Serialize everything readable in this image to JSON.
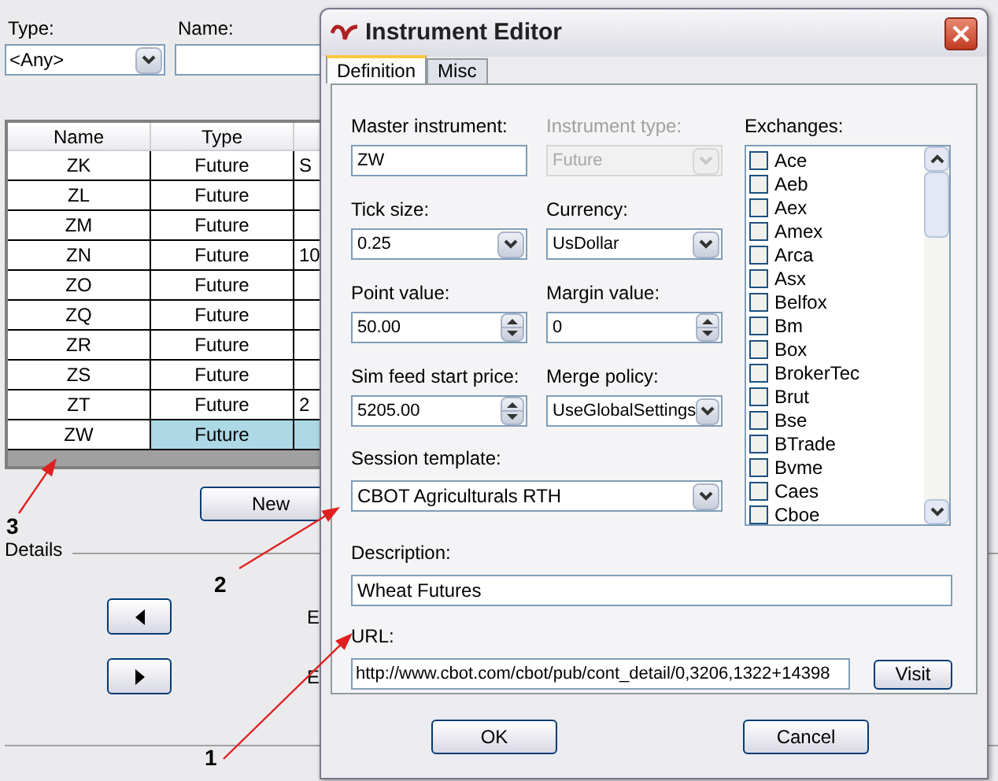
{
  "filter": {
    "type_label": "Type:",
    "type_value": "<Any>",
    "name_label": "Name:"
  },
  "table": {
    "columns": [
      "Name",
      "Type"
    ],
    "rows": [
      {
        "cells": [
          "ZK",
          "Future"
        ],
        "column_3": "S",
        "selected": false
      },
      {
        "cells": [
          "ZL",
          "Future"
        ],
        "selected": false
      },
      {
        "cells": [
          "ZM",
          "Future"
        ],
        "selected": false
      },
      {
        "cells": [
          "ZN",
          "Future"
        ],
        "column_3": "10",
        "selected": false
      },
      {
        "cells": [
          "ZO",
          "Future"
        ],
        "selected": false
      },
      {
        "cells": [
          "ZQ",
          "Future"
        ],
        "selected": false
      },
      {
        "cells": [
          "ZR",
          "Future"
        ],
        "selected": false
      },
      {
        "cells": [
          "ZS",
          "Future"
        ],
        "selected": false
      },
      {
        "cells": [
          "ZT",
          "Future"
        ],
        "column_3": "2",
        "selected": false
      },
      {
        "cells": [
          "ZW",
          "Future"
        ],
        "selected": true
      }
    ]
  },
  "new_button": "New",
  "details_label": "Details",
  "nav_buttons": [
    {
      "kind": "left",
      "label": "E"
    },
    {
      "kind": "right",
      "label": "E"
    }
  ],
  "dialog": {
    "title": "Instrument Editor",
    "tabs": [
      {
        "label": "Definition",
        "selected": true
      },
      {
        "label": "Misc",
        "selected": false
      }
    ],
    "fields": [
      {
        "label": "Master instrument:",
        "kind": "text",
        "value": "ZW",
        "disabled": false
      },
      {
        "label": "Instrument type:",
        "kind": "select",
        "value": "Future",
        "disabled": true
      },
      {
        "label": "Tick size:",
        "kind": "select",
        "value": "0.25",
        "disabled": false
      },
      {
        "label": "Currency:",
        "kind": "select",
        "value": "UsDollar",
        "disabled": false
      },
      {
        "label": "Point value:",
        "kind": "spin",
        "value": "50.00",
        "disabled": false
      },
      {
        "label": "Margin value:",
        "kind": "spin",
        "value": "0",
        "disabled": false
      },
      {
        "label": "Sim feed start price:",
        "kind": "spin",
        "value": "5205.00",
        "disabled": false
      },
      {
        "label": "Merge policy:",
        "kind": "select",
        "value": "UseGlobalSettings",
        "disabled": false
      }
    ],
    "session_template": {
      "label": "Session template:",
      "value": "CBOT Agriculturals RTH"
    },
    "exchanges": {
      "label": "Exchanges:",
      "items": [
        {
          "label": "Ace",
          "checked": false
        },
        {
          "label": "Aeb",
          "checked": false
        },
        {
          "label": "Aex",
          "checked": false
        },
        {
          "label": "Amex",
          "checked": false
        },
        {
          "label": "Arca",
          "checked": false
        },
        {
          "label": "Asx",
          "checked": false
        },
        {
          "label": "Belfox",
          "checked": false
        },
        {
          "label": "Bm",
          "checked": false
        },
        {
          "label": "Box",
          "checked": false
        },
        {
          "label": "BrokerTec",
          "checked": false
        },
        {
          "label": "Brut",
          "checked": false
        },
        {
          "label": "Bse",
          "checked": false
        },
        {
          "label": "BTrade",
          "checked": false
        },
        {
          "label": "Bvme",
          "checked": false
        },
        {
          "label": "Caes",
          "checked": false
        },
        {
          "label": "Cboe",
          "checked": false
        }
      ]
    },
    "description": {
      "label": "Description:",
      "value": "Wheat Futures"
    },
    "url": {
      "label": "URL:",
      "value": "http://www.cbot.com/cbot/pub/cont_detail/0,3206,1322+14398"
    },
    "visit_button": "Visit",
    "buttons": [
      "OK",
      "Cancel"
    ]
  },
  "annotations": [
    {
      "label": "3"
    },
    {
      "label": "2"
    },
    {
      "label": "1"
    }
  ]
}
